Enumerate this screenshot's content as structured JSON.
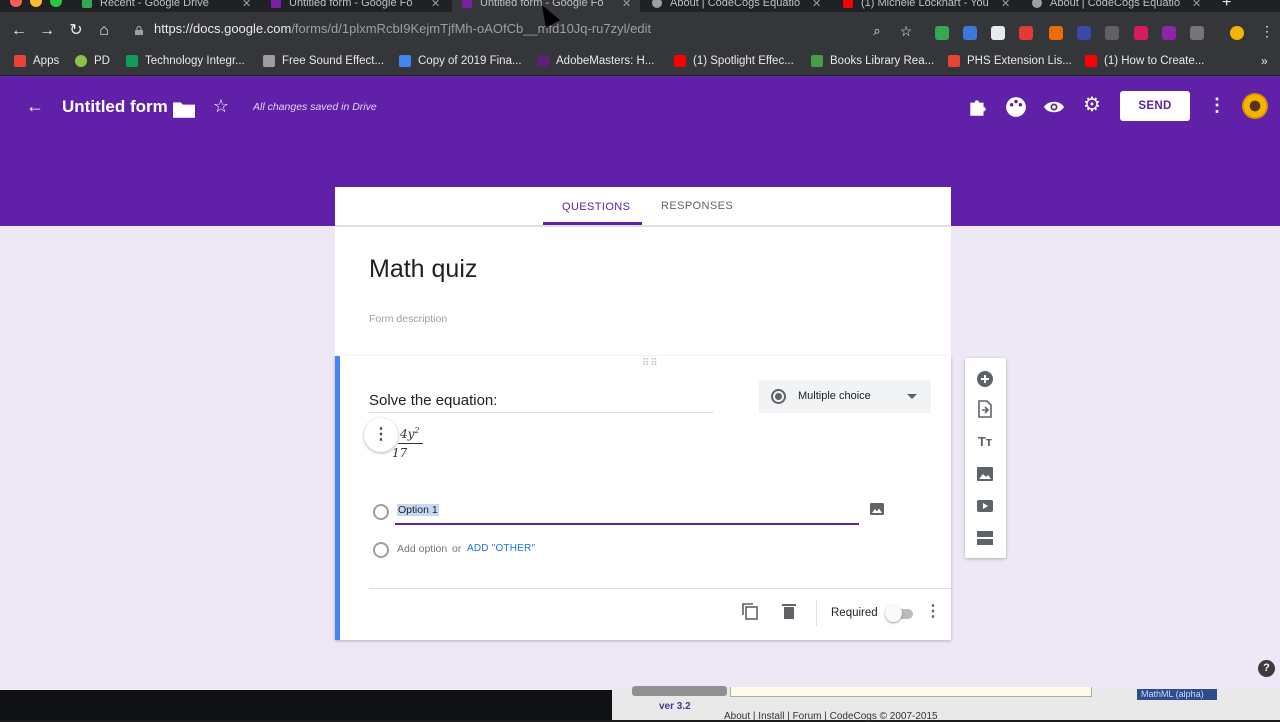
{
  "browser": {
    "tabs": [
      {
        "title": "Recent - Google Drive",
        "color": "#34a853"
      },
      {
        "title": "Untitled form - Google Fo",
        "color": "#7b1fa2"
      },
      {
        "title": "Untitled form - Google Fo",
        "color": "#7b1fa2",
        "active": true
      },
      {
        "title": "About | CodeCogs Equatio",
        "color": "#9aa0a6"
      },
      {
        "title": "(1) Michele Lockhart - You",
        "color": "#ff0000"
      },
      {
        "title": "About | CodeCogs Equatio",
        "color": "#9aa0a6"
      }
    ],
    "url_host": "https://docs.google.com",
    "url_path": "/forms/d/1plxmRcbI9KejmTjfMh-oAOfCb__mfd10Jq-ru7zyl/edit",
    "bookmarks": [
      {
        "label": "Apps",
        "color": "#ea4335"
      },
      {
        "label": "PD",
        "color": "#8bc34a"
      },
      {
        "label": "Technology Integr...",
        "color": "#0f9d58"
      },
      {
        "label": "Free Sound Effect...",
        "color": "#9e9e9e"
      },
      {
        "label": "Copy of 2019 Fina...",
        "color": "#4285f4"
      },
      {
        "label": "AdobeMasters: H...",
        "color": "#5c1f7a"
      },
      {
        "label": "(1) Spotlight Effec...",
        "color": "#ff0000"
      },
      {
        "label": "Books Library Rea...",
        "color": "#43a047"
      },
      {
        "label": "PHS Extension Lis...",
        "color": "#ea4335"
      },
      {
        "label": "(1) How to Create...",
        "color": "#ff0000"
      }
    ]
  },
  "appbar": {
    "title": "Untitled form",
    "saved_status": "All changes saved in Drive",
    "send_label": "SEND"
  },
  "form_tabs": {
    "questions": "QUESTIONS",
    "responses": "RESPONSES"
  },
  "form": {
    "title": "Math quiz",
    "description_placeholder": "Form description"
  },
  "question": {
    "title": "Solve the equation:",
    "type": "Multiple choice",
    "equation_numerator": "4y",
    "equation_exponent": "2",
    "equation_denominator": "17",
    "option_1": "Option 1",
    "add_option": "Add option",
    "or": "or",
    "add_other": "ADD \"OTHER\"",
    "required_label": "Required",
    "required": false
  },
  "behind_window": {
    "version": "ver 3.2",
    "footer": "About | Install | Forum | CodeCogs © 2007-2015",
    "badge": "MathML (alpha)"
  },
  "colors": {
    "brand_purple": "#6020a8",
    "accent_blue": "#4285f4",
    "page_bg": "#ede7f6"
  }
}
